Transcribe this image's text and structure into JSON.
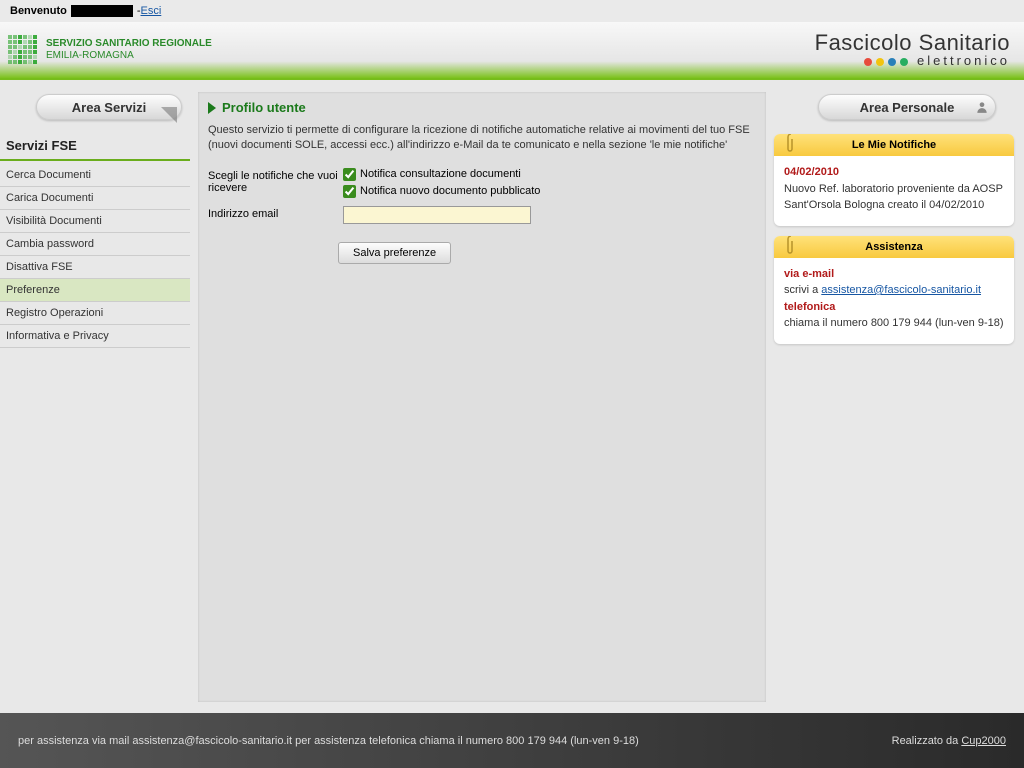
{
  "topbar": {
    "welcome": "Benvenuto",
    "logout": "Esci"
  },
  "header": {
    "org_line1": "SERVIZIO SANITARIO REGIONALE",
    "org_line2": "EMILIA-ROMAGNA",
    "brand": "Fascicolo Sanitario",
    "brand_sub": "elettronico"
  },
  "left_nav": {
    "area_servizi": "Area Servizi",
    "section_title": "Servizi FSE",
    "items": [
      "Cerca Documenti",
      "Carica Documenti",
      "Visibilità Documenti",
      "Cambia password",
      "Disattiva FSE",
      "Preferenze",
      "Registro Operazioni",
      "Informativa e Privacy"
    ],
    "active_index": 5
  },
  "main": {
    "title": "Profilo utente",
    "intro": "Questo servizio ti permette di configurare la ricezione di notifiche automatiche relative ai movimenti del tuo FSE (nuovi documenti SOLE, accessi ecc.) all'indirizzo e-Mail da te comunicato e nella sezione 'le mie notifiche'",
    "choose_label": "Scegli le notifiche che vuoi ricevere",
    "chk1": "Notifica consultazione documenti",
    "chk2": "Notifica nuovo documento pubblicato",
    "email_label": "Indirizzo email",
    "email_value": "",
    "save_button": "Salva preferenze"
  },
  "right_nav": {
    "area_personale": "Area Personale"
  },
  "widgets": {
    "notifiche": {
      "title": "Le Mie Notifiche",
      "date": "04/02/2010",
      "text": "Nuovo Ref. laboratorio proveniente da AOSP Sant'Orsola Bologna creato il 04/02/2010"
    },
    "assistenza": {
      "title": "Assistenza",
      "via_email": "via e-mail",
      "email_prefix": "scrivi a ",
      "email_link": "assistenza@fascicolo-sanitario.it",
      "telefonica": "telefonica",
      "phone_text": "chiama il numero 800 179 944 (lun-ven 9-18)"
    }
  },
  "footer": {
    "left": "per assistenza via mail assistenza@fascicolo-sanitario.it   per assistenza telefonica chiama il numero 800 179 944 (lun-ven 9-18)",
    "right_prefix": "Realizzato da ",
    "right_link": "Cup2000"
  }
}
